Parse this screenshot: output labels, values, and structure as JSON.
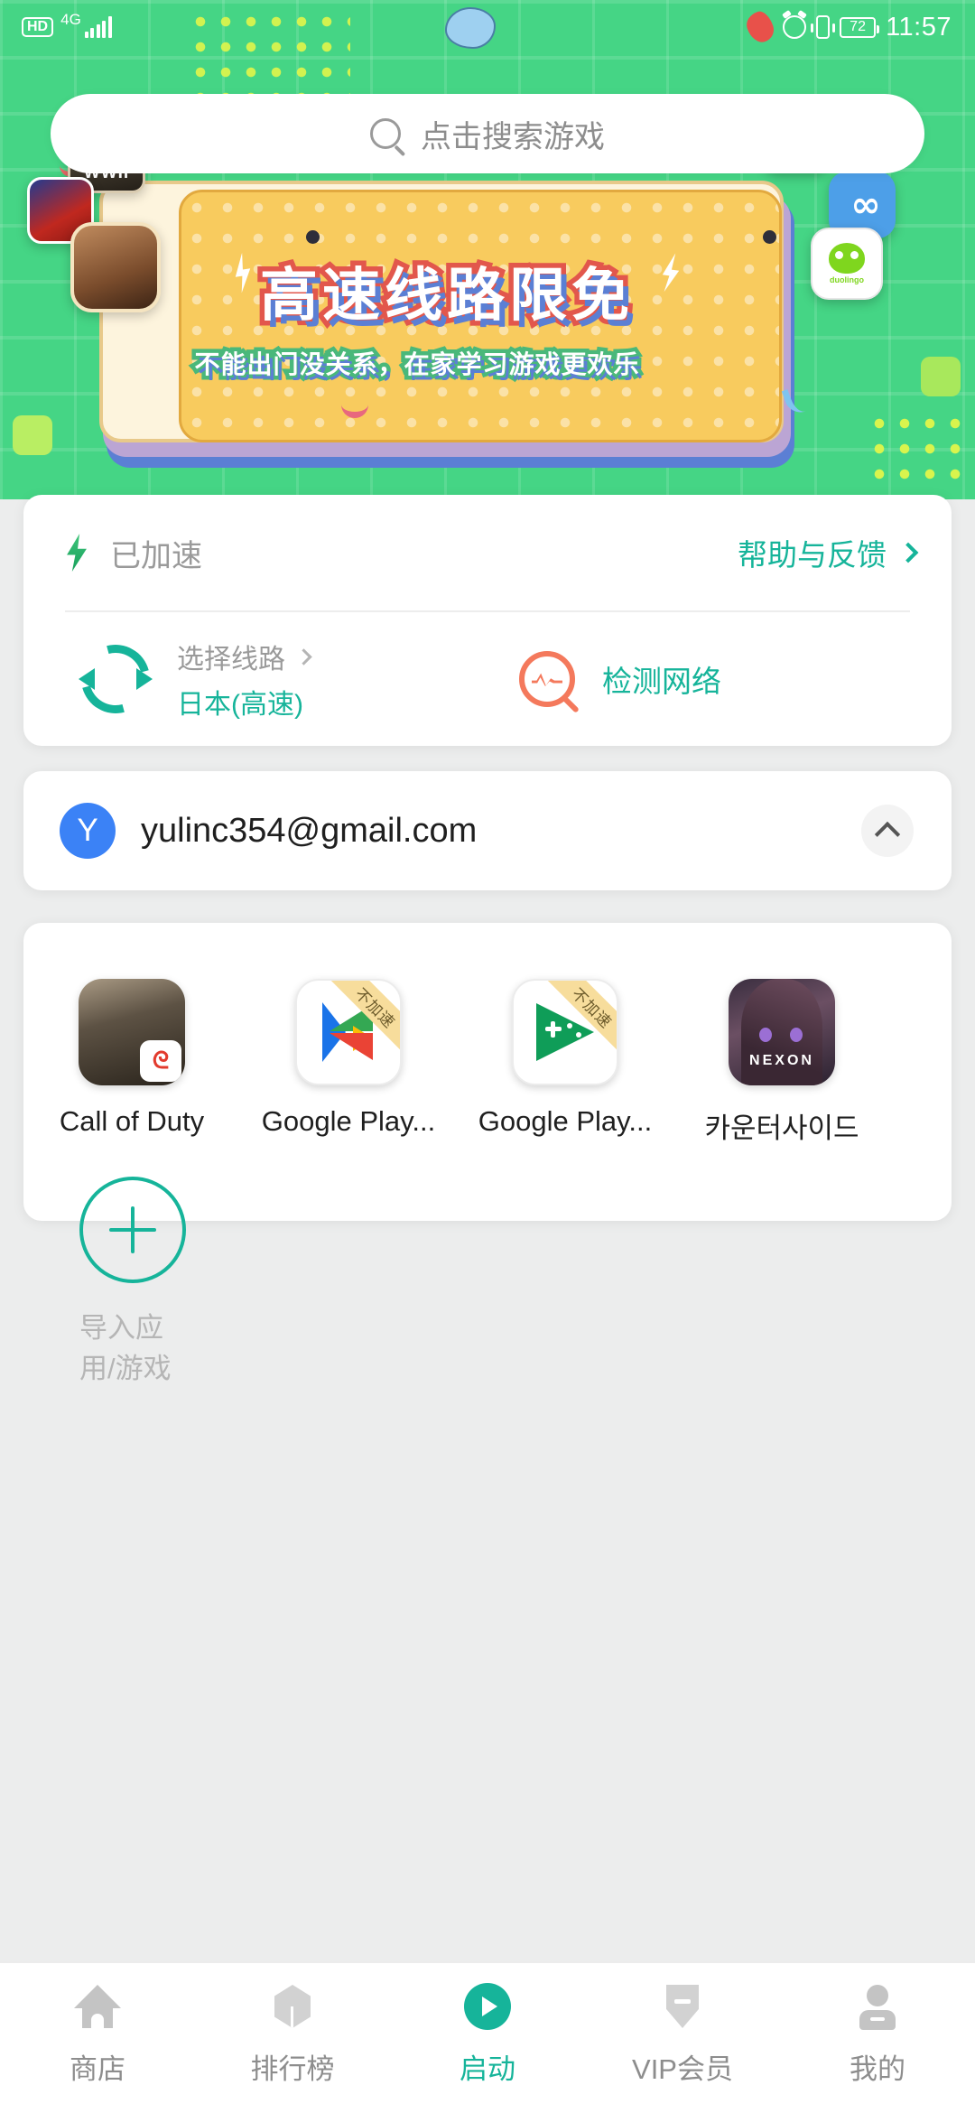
{
  "statusbar": {
    "hd": "HD",
    "network": "4G",
    "battery": "72",
    "time": "11:57",
    "icons": [
      "hd-badge",
      "signal-bars",
      "cloud-decoration",
      "worm-decoration",
      "alarm-icon",
      "vibrate-icon",
      "battery-icon"
    ]
  },
  "search": {
    "placeholder": "点击搜索游戏",
    "icon": "search-icon"
  },
  "banner": {
    "title": "高速线路限免",
    "subtitle": "不能出门没关系，在家学习游戏更欢乐",
    "floating_icons": [
      {
        "name": "wwii-game-icon",
        "label": "WWII"
      },
      {
        "name": "fifa-game-icon",
        "label": ""
      },
      {
        "name": "soldier-game-icon",
        "label": ""
      },
      {
        "name": "vip-app-icon",
        "label": ""
      },
      {
        "name": "cc-app-icon",
        "label": "∞"
      },
      {
        "name": "duolingo-app-icon",
        "label": "duolingo"
      }
    ]
  },
  "accel_card": {
    "status_label": "已加速",
    "status_icon": "bolt-icon",
    "help_label": "帮助与反馈",
    "route_label": "选择线路",
    "route_value": "日本(高速)",
    "route_icon": "sync-icon",
    "netcheck_label": "检测网络",
    "netcheck_icon": "network-scan-icon"
  },
  "account": {
    "avatar_letter": "Y",
    "email": "yulinc354@gmail.com",
    "collapse_icon": "chevron-up-icon"
  },
  "apps": {
    "items": [
      {
        "name": "Call of Duty",
        "icon": "call-of-duty-icon",
        "badge": ""
      },
      {
        "name": "Google Play...",
        "icon": "google-play-store-icon",
        "badge": "不加速"
      },
      {
        "name": "Google Play...",
        "icon": "google-play-games-icon",
        "badge": "不加速"
      },
      {
        "name": "카운터사이드",
        "icon": "counterside-nexon-icon",
        "badge": ""
      }
    ],
    "add_label": "导入应用/游戏",
    "add_icon": "plus-icon"
  },
  "bottom_nav": {
    "items": [
      {
        "label": "商店",
        "icon": "home-icon",
        "active": false
      },
      {
        "label": "排行榜",
        "icon": "rank-icon",
        "active": false
      },
      {
        "label": "启动",
        "icon": "launch-play-icon",
        "active": true
      },
      {
        "label": "VIP会员",
        "icon": "vip-diamond-icon",
        "active": false
      },
      {
        "label": "我的",
        "icon": "profile-icon",
        "active": false
      }
    ]
  },
  "colors": {
    "accent_green": "#45d585",
    "teal": "#16b49a",
    "banner_yellow": "#f8cb5e",
    "banner_red": "#e2574c",
    "orange": "#f4795c",
    "avatar_blue": "#3b82f6"
  }
}
